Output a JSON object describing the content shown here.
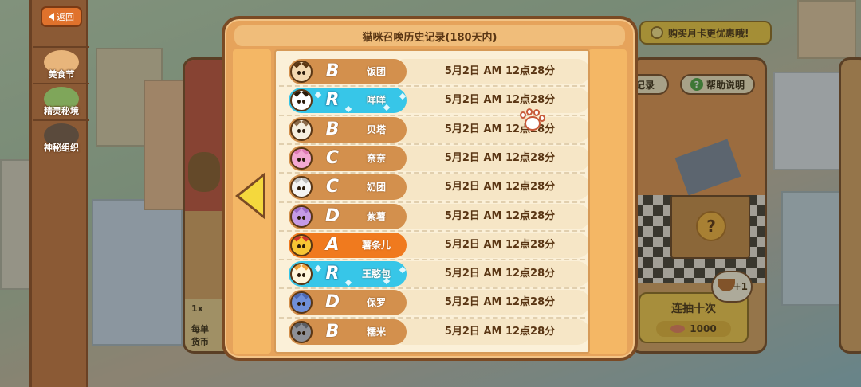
{
  "sidebar": {
    "back_label": "返回",
    "items": [
      {
        "label": "美食节",
        "color": "#e8b57b"
      },
      {
        "label": "精灵秘境",
        "color": "#7fa65a"
      },
      {
        "label": "神秘组织",
        "color": "#5a4a3c"
      }
    ]
  },
  "buy_bar": {
    "label": "购买月卡更优惠哦!"
  },
  "right_card": {
    "record_label": "记录",
    "help_label": "帮助说明",
    "help_icon": "?",
    "box_icon": "?",
    "ten_draw_label": "连抽十次",
    "ten_draw_price": "1000",
    "plus_badge": "+1"
  },
  "left_card": {
    "count": "1x",
    "line1": "每单",
    "line2": "货币"
  },
  "modal": {
    "title": "猫咪召唤历史记录(180天内)",
    "records": [
      {
        "grade": "B",
        "name": "饭团",
        "time": "5月2日 AM 12点28分",
        "rarity": "B",
        "avatar_color": "#f3d8b0",
        "ear_color": "#5a3614"
      },
      {
        "grade": "R",
        "name": "咩咩",
        "time": "5月2日 AM 12点28分",
        "rarity": "R",
        "avatar_color": "#ffffff",
        "ear_color": "#2a1a0a"
      },
      {
        "grade": "B",
        "name": "贝塔",
        "time": "5月2日 AM 12点28分",
        "rarity": "B",
        "avatar_color": "#f6efe0",
        "ear_color": "#8a6a4a"
      },
      {
        "grade": "C",
        "name": "奈奈",
        "time": "5月2日 AM 12点28分",
        "rarity": "C",
        "avatar_color": "#f3a8d2",
        "ear_color": "#e07cb8"
      },
      {
        "grade": "C",
        "name": "奶团",
        "time": "5月2日 AM 12点28分",
        "rarity": "C",
        "avatar_color": "#f4f4f4",
        "ear_color": "#c0c0c0"
      },
      {
        "grade": "D",
        "name": "紫薯",
        "time": "5月2日 AM 12点28分",
        "rarity": "D",
        "avatar_color": "#c59be6",
        "ear_color": "#9c6cc8"
      },
      {
        "grade": "A",
        "name": "薯条儿",
        "time": "5月2日 AM 12点28分",
        "rarity": "A",
        "avatar_color": "#f7c634",
        "ear_color": "#d0342a"
      },
      {
        "grade": "R",
        "name": "王憨包",
        "time": "5月2日 AM 12点28分",
        "rarity": "R",
        "avatar_color": "#fff6dc",
        "ear_color": "#f2a23a"
      },
      {
        "grade": "D",
        "name": "保罗",
        "time": "5月2日 AM 12点28分",
        "rarity": "D",
        "avatar_color": "#6f8fd8",
        "ear_color": "#4a66b0"
      },
      {
        "grade": "B",
        "name": "糯米",
        "time": "5月2日 AM 12点28分",
        "rarity": "B",
        "avatar_color": "#8d8f96",
        "ear_color": "#5a5c62"
      }
    ]
  },
  "colors": {
    "frame": "#7a4a24",
    "panel": "#e6a35b",
    "rare_R": "#37c6e8",
    "rare_A": "#f07a1e",
    "normal": "#d3904d"
  }
}
